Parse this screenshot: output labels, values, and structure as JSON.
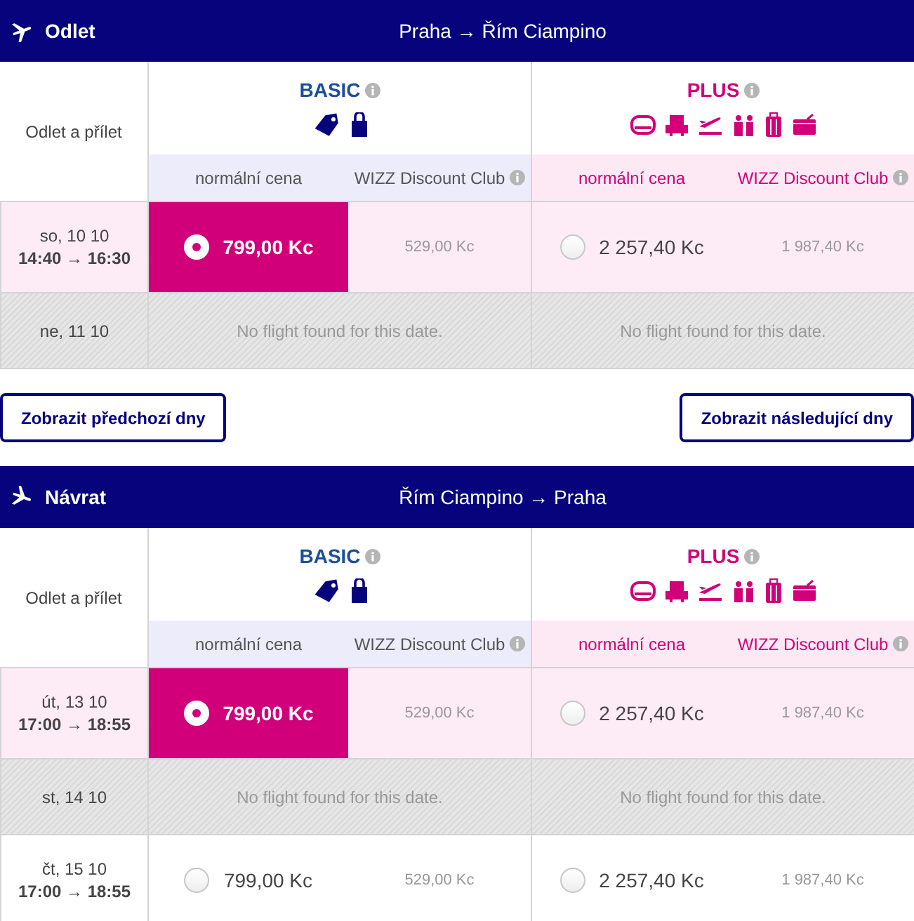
{
  "sections": [
    {
      "kind": "outbound",
      "title": "Odlet",
      "route": "Praha → Řím Ciampino",
      "time_label": "Odlet a přílet",
      "fares": [
        {
          "kind": "basic",
          "name": "BASIC",
          "normal_label": "normální cena",
          "club_label": "WIZZ Discount Club"
        },
        {
          "kind": "plus",
          "name": "PLUS",
          "normal_label": "normální cena",
          "club_label": "WIZZ Discount Club"
        }
      ],
      "rows": [
        {
          "kind": "flight",
          "date": "so, 10 10",
          "times": "14:40 → 16:30",
          "prices": [
            {
              "normal": "799,00 Kc",
              "club": "529,00 Kc",
              "selected": true
            },
            {
              "normal": "2 257,40 Kc",
              "club": "1 987,40 Kc",
              "selected": false
            }
          ]
        },
        {
          "kind": "none",
          "date": "ne, 11 10",
          "messages": [
            "No flight found for this date.",
            "No flight found for this date."
          ]
        }
      ],
      "nav_buttons": [
        "Zobrazit předchozí dny",
        "Zobrazit následující dny"
      ]
    },
    {
      "kind": "inbound",
      "title": "Návrat",
      "route": "Řím Ciampino → Praha",
      "time_label": "Odlet a přílet",
      "fares": [
        {
          "kind": "basic",
          "name": "BASIC",
          "normal_label": "normální cena",
          "club_label": "WIZZ Discount Club"
        },
        {
          "kind": "plus",
          "name": "PLUS",
          "normal_label": "normální cena",
          "club_label": "WIZZ Discount Club"
        }
      ],
      "rows": [
        {
          "kind": "flight",
          "date": "út, 13 10",
          "times": "17:00 → 18:55",
          "prices": [
            {
              "normal": "799,00 Kc",
              "club": "529,00 Kc",
              "selected": true
            },
            {
              "normal": "2 257,40 Kc",
              "club": "1 987,40 Kc",
              "selected": false
            }
          ]
        },
        {
          "kind": "none",
          "date": "st, 14 10",
          "messages": [
            "No flight found for this date.",
            "No flight found for this date."
          ]
        },
        {
          "kind": "flight",
          "date": "čt, 15 10",
          "times": "17:00 → 18:55",
          "prices": [
            {
              "normal": "799,00 Kc",
              "club": "529,00 Kc",
              "selected": false
            },
            {
              "normal": "2 257,40 Kc",
              "club": "1 987,40 Kc",
              "selected": false
            }
          ]
        }
      ]
    }
  ]
}
